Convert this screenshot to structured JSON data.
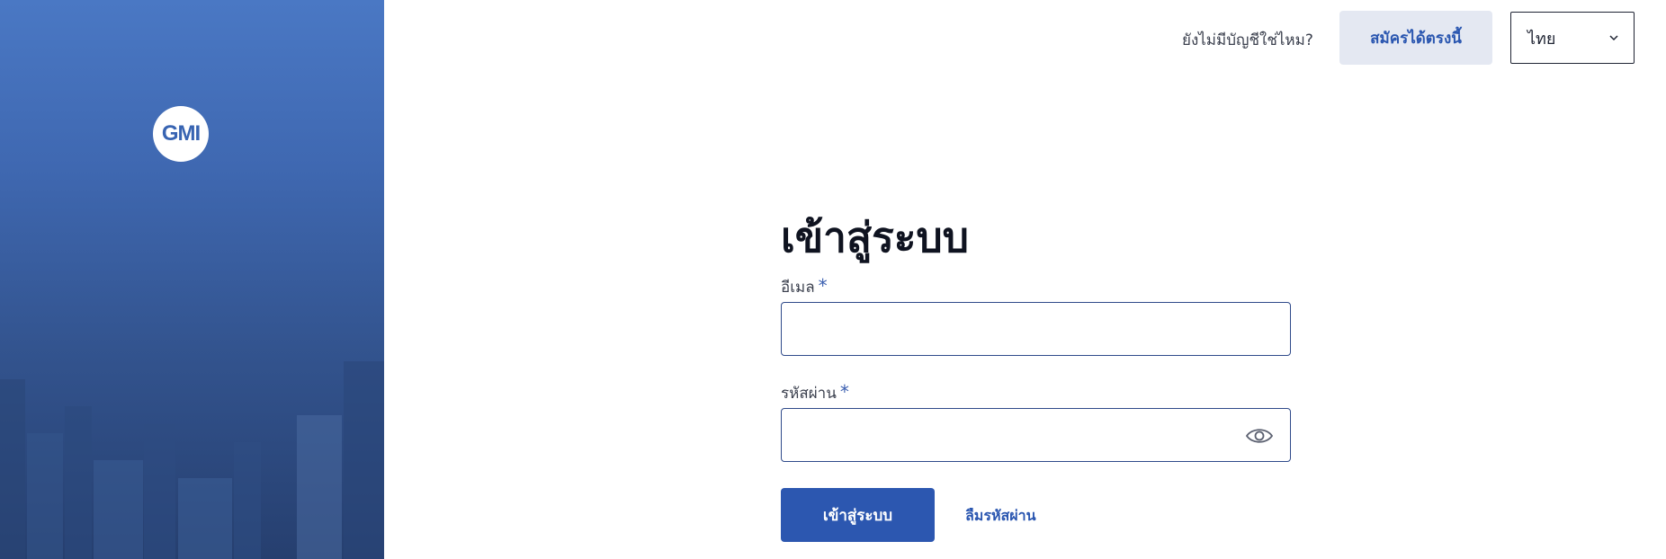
{
  "brand": {
    "logo_text": "GMI"
  },
  "header": {
    "no_account_text": "ยังไม่มีบัญชีใช่ไหม?",
    "signup_label": "สมัครได้ตรงนี้",
    "language_selected": "ไทย"
  },
  "login": {
    "title": "เข้าสู่ระบบ",
    "email_label": "อีเมล",
    "email_value": "",
    "password_label": "รหัสผ่าน",
    "password_value": "",
    "required_mark": "*",
    "submit_label": "เข้าสู่ระบบ",
    "forgot_label": "ลืมรหัสผ่าน"
  },
  "icons": {
    "password_toggle": "eye-icon",
    "language_dropdown": "chevron-down-icon"
  },
  "colors": {
    "primary": "#2c57b0",
    "hero_top": "#4a78c4",
    "hero_bottom": "#263f6f",
    "signup_bg": "#e4e8f2"
  }
}
